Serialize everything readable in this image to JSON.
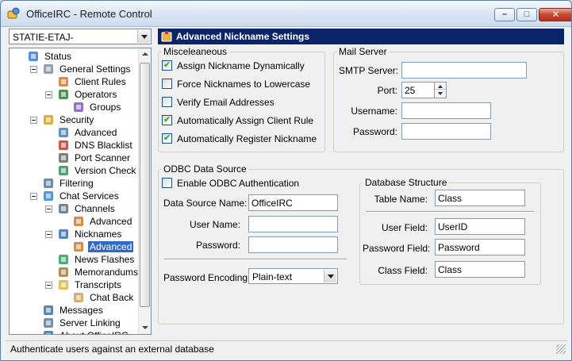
{
  "window": {
    "title": "OfficeIRC - Remote Control",
    "minimize_glyph": "–",
    "maximize_glyph": "□",
    "close_glyph": "✕"
  },
  "server_combo": {
    "value": "STATIE-ETAJ-"
  },
  "tree": [
    {
      "label": "Status",
      "icon": "status-icon"
    },
    {
      "label": "General Settings",
      "icon": "gears-icon"
    },
    {
      "label": "Client Rules",
      "icon": "users-icon"
    },
    {
      "label": "Operators",
      "icon": "operator-icon"
    },
    {
      "label": "Groups",
      "icon": "groups-icon"
    },
    {
      "label": "Security",
      "icon": "lock-icon"
    },
    {
      "label": "Advanced",
      "icon": "advanced-icon"
    },
    {
      "label": "DNS Blacklist",
      "icon": "blacklist-icon"
    },
    {
      "label": "Port Scanner",
      "icon": "scanner-icon"
    },
    {
      "label": "Version Check",
      "icon": "version-check-icon"
    },
    {
      "label": "Filtering",
      "icon": "filter-icon"
    },
    {
      "label": "Chat Services",
      "icon": "globe-icon"
    },
    {
      "label": "Channels",
      "icon": "channels-icon"
    },
    {
      "label": "Advanced",
      "icon": "advanced-icon"
    },
    {
      "label": "Nicknames",
      "icon": "nicknames-icon"
    },
    {
      "label": "Advanced",
      "icon": "advanced-icon"
    },
    {
      "label": "News Flashes",
      "icon": "news-icon"
    },
    {
      "label": "Memorandums",
      "icon": "memo-icon"
    },
    {
      "label": "Transcripts",
      "icon": "folder-icon"
    },
    {
      "label": "Chat Back",
      "icon": "chat-back-icon"
    },
    {
      "label": "Messages",
      "icon": "messages-icon"
    },
    {
      "label": "Server Linking",
      "icon": "link-icon"
    },
    {
      "label": "About OfficeIRC",
      "icon": "about-icon"
    }
  ],
  "header": {
    "title": "Advanced Nickname Settings"
  },
  "misc": {
    "title": "Misceleaneous",
    "options": [
      {
        "label": "Assign Nickname Dynamically",
        "checked": true
      },
      {
        "label": "Force Nicknames to Lowercase",
        "checked": false
      },
      {
        "label": "Verify Email Addresses",
        "checked": false
      },
      {
        "label": "Automatically Assign Client Rule",
        "checked": true
      },
      {
        "label": "Automatically Register Nickname",
        "checked": true
      }
    ]
  },
  "mail": {
    "title": "Mail Server",
    "smtp_label": "SMTP Server:",
    "smtp_value": "",
    "port_label": "Port:",
    "port_value": "25",
    "username_label": "Username:",
    "username_value": "",
    "password_label": "Password:",
    "password_value": ""
  },
  "odbc": {
    "title": "ODBC Data Source",
    "enable_label": "Enable ODBC Authentication",
    "enable_checked": false,
    "dsn_label": "Data Source Name:",
    "dsn_value": "OfficeIRC",
    "user_label": "User Name:",
    "user_value": "",
    "password_label": "Password:",
    "password_value": "",
    "encoding_label": "Password Encoding:",
    "encoding_value": "Plain-text"
  },
  "db": {
    "title": "Database Structure",
    "table_label": "Table Name:",
    "table_value": "Class",
    "user_field_label": "User Field:",
    "user_field_value": "UserID",
    "password_field_label": "Password Field:",
    "password_field_value": "Password",
    "class_field_label": "Class Field:",
    "class_field_value": "Class"
  },
  "status_bar": {
    "text": "Authenticate users against an external database"
  }
}
